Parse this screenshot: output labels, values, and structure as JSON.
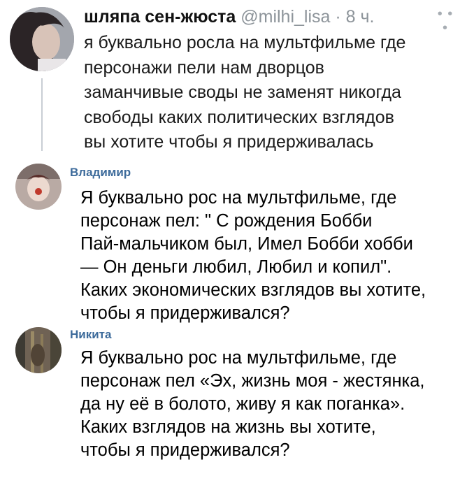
{
  "tweet": {
    "name": "шляпа сен-жюста",
    "handle": "@milhi_lisa",
    "separator": "·",
    "time": "8 ч.",
    "more_icon": "more-dots-icon",
    "lines": [
      "я буквально росла на мультфильме где",
      "персонажи пели нам дворцов",
      "заманчивые своды не заменят никогда",
      "свободы каких политических взглядов",
      "вы хотите чтобы я придерживалась"
    ]
  },
  "comments": [
    {
      "name": "Владимир",
      "lines": [
        "Я буквально рос на мультфильме, где",
        "персонаж пел: \"  С рождения Бобби",
        "Пай-мальчиком был, Имел Бобби хобби",
        "— Он деньги любил, Любил и копил\".",
        "Каких экономических взглядов вы хотите,",
        "чтобы я придерживался?"
      ]
    },
    {
      "name": "Никита",
      "lines": [
        "Я буквально рос на мультфильме, где",
        "персонаж пел «Эх, жизнь моя - жестянка,",
        "да ну её в болото, живу я как поганка».",
        "Каких взглядов на жизнь вы хотите,",
        "чтобы я придерживался?"
      ]
    }
  ]
}
